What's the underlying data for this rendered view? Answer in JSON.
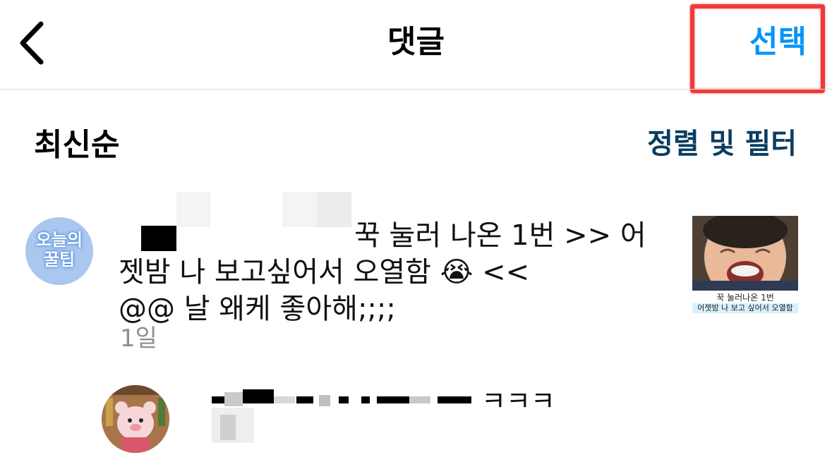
{
  "colors": {
    "accent_blue": "#0095f6",
    "dark_blue": "#0a3d62",
    "highlight_red": "#f0393a",
    "muted_gray": "#8e8e8e"
  },
  "header": {
    "back_icon": "chevron-left-icon",
    "title": "댓글",
    "select_label": "선택"
  },
  "sort": {
    "label": "최신순",
    "filter_label": "정렬 및 필터"
  },
  "comments": [
    {
      "avatar_text_line1": "오늘의",
      "avatar_text_line2": "꿀팁",
      "line1": "꾹 눌러 나온 1번 >> 어",
      "line2": "젯밤 나 보고싶어서 오열함 😭 <<",
      "line3": "@@ 날 왜케 좋아해;;;;",
      "time": "1일",
      "thumbnail": {
        "caption_line1": "꾹 눌러나온 1번",
        "caption_line2": "어젯밤 나 보고 싶어서 오열함"
      }
    },
    {
      "text": "ㅋㅋㅋ"
    }
  ]
}
